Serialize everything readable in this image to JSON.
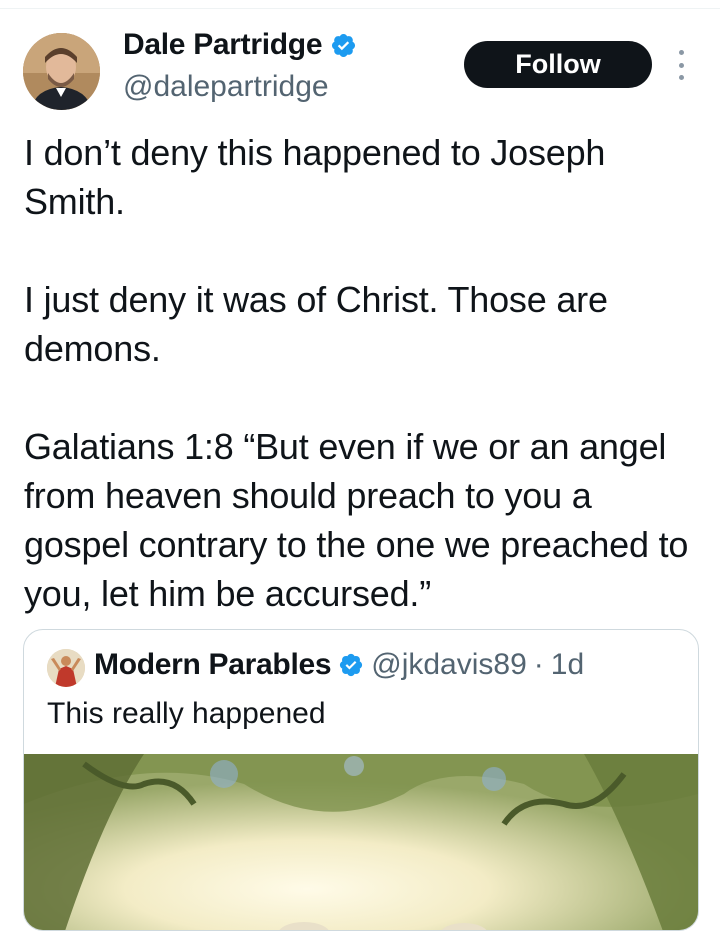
{
  "tweet": {
    "author": {
      "display_name": "Dale Partridge",
      "handle": "@dalepartridge",
      "verified": true,
      "verified_color": "#1d9bf0"
    },
    "follow_label": "Follow",
    "text": "I don’t deny this happened to Joseph Smith.\n\nI just deny it was of Christ. Those are demons.\n\nGalatians 1:8 “But even if we or an angel from heaven should preach to you a gospel contrary to the one we preached to you, let him be accursed.”"
  },
  "quoted_tweet": {
    "author": {
      "display_name": "Modern Parables",
      "handle": "@jkdavis89",
      "verified": true
    },
    "separator": "·",
    "timestamp": "1d",
    "text": "This really happened",
    "media": {
      "type": "image",
      "description": "painting-of-forest-light"
    }
  },
  "icons": {
    "verified": "verified-badge-icon",
    "more": "more-vertical-icon"
  }
}
